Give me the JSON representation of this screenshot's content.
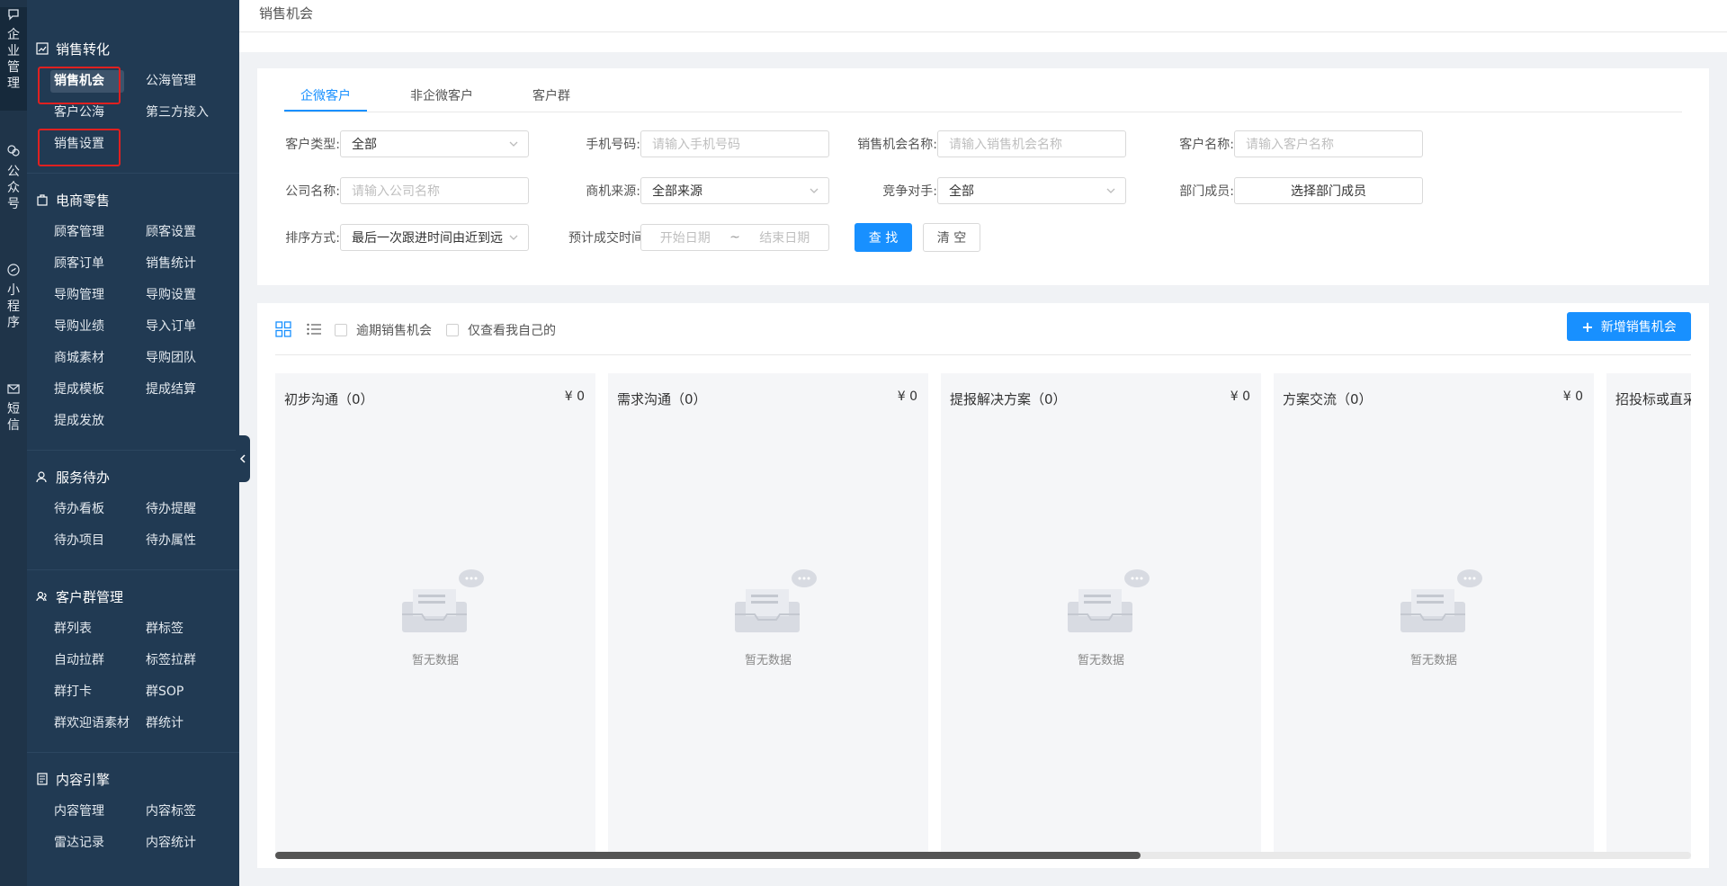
{
  "rail": [
    {
      "label": "企业管理",
      "icon": "chat-bubble-icon",
      "active": true
    },
    {
      "label": "公众号",
      "icon": "wechat-icon"
    },
    {
      "label": "小程序",
      "icon": "miniprogram-icon"
    },
    {
      "label": "短信",
      "icon": "mail-icon"
    }
  ],
  "menu": {
    "sections": [
      {
        "title": "销售转化",
        "icon": "chart-icon",
        "items": [
          "销售机会",
          "公海管理",
          "客户公海",
          "第三方接入",
          "销售设置"
        ]
      },
      {
        "title": "电商零售",
        "icon": "bag-icon",
        "items": [
          "顾客管理",
          "顾客设置",
          "顾客订单",
          "销售统计",
          "导购管理",
          "导购设置",
          "导购业绩",
          "导入订单",
          "商城素材",
          "导购团队",
          "提成模板",
          "提成结算",
          "提成发放"
        ]
      },
      {
        "title": "服务待办",
        "icon": "user-icon",
        "items": [
          "待办看板",
          "待办提醒",
          "待办项目",
          "待办属性"
        ]
      },
      {
        "title": "客户群管理",
        "icon": "group-icon",
        "items": [
          "群列表",
          "群标签",
          "自动拉群",
          "标签拉群",
          "群打卡",
          "群SOP",
          "群欢迎语素材",
          "群统计"
        ]
      },
      {
        "title": "内容引擎",
        "icon": "doc-icon",
        "items": [
          "内容管理",
          "内容标签",
          "雷达记录",
          "内容统计"
        ]
      }
    ]
  },
  "page": {
    "title": "销售机会"
  },
  "tabs": [
    "企微客户",
    "非企微客户",
    "客户群"
  ],
  "filters": {
    "customer_type": {
      "label": "客户类型:",
      "value": "全部"
    },
    "phone": {
      "label": "手机号码:",
      "placeholder": "请输入手机号码"
    },
    "opp_name": {
      "label": "销售机会名称:",
      "placeholder": "请输入销售机会名称"
    },
    "customer_name": {
      "label": "客户名称:",
      "placeholder": "请输入客户名称"
    },
    "company": {
      "label": "公司名称:",
      "placeholder": "请输入公司名称"
    },
    "source": {
      "label": "商机来源:",
      "value": "全部来源"
    },
    "competitor": {
      "label": "竞争对手:",
      "value": "全部"
    },
    "member": {
      "label": "部门成员:",
      "value": "选择部门成员"
    },
    "sort": {
      "label": "排序方式:",
      "value": "最后一次跟进时间由近到远"
    },
    "deal_time": {
      "label": "预计成交时间:",
      "start": "开始日期",
      "sep": "~",
      "end": "结束日期"
    },
    "search_btn": "查 找",
    "clear_btn": "清 空"
  },
  "toolbar": {
    "overdue": "逾期销售机会",
    "mine": "仅查看我自己的",
    "add_btn": "新增销售机会",
    "add_plus": "+"
  },
  "columns": [
    {
      "title": "初步沟通（0）",
      "amount": "¥ 0",
      "empty": "暂无数据"
    },
    {
      "title": "需求沟通（0）",
      "amount": "¥ 0",
      "empty": "暂无数据"
    },
    {
      "title": "提报解决方案（0）",
      "amount": "¥ 0",
      "empty": "暂无数据"
    },
    {
      "title": "方案交流（0）",
      "amount": "¥ 0",
      "empty": "暂无数据"
    },
    {
      "title": "招投标或直采",
      "amount": "",
      "empty": ""
    }
  ],
  "colors": {
    "primary": "#1890ff",
    "sidebar": "#213a53",
    "rail": "#1f3449",
    "highlight": "#e02020"
  }
}
